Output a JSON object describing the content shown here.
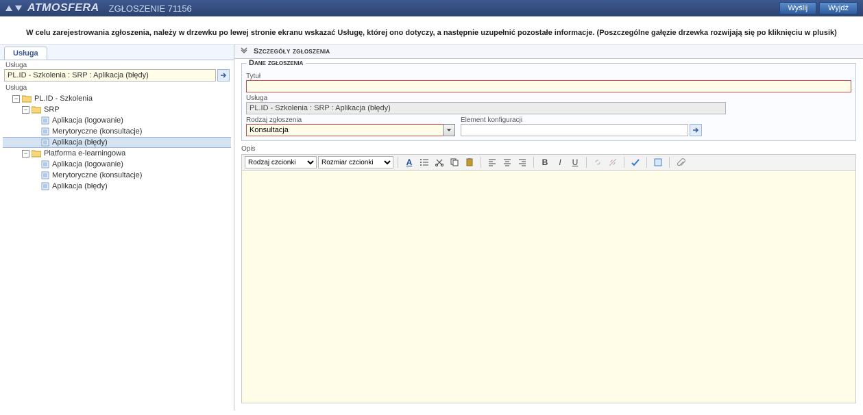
{
  "header": {
    "brand": "ATMOSFERA",
    "title": "ZGŁOSZENIE 71156",
    "send": "Wyślij",
    "exit": "Wyjdź"
  },
  "instruction": "W celu zarejestrowania zgłoszenia, należy w drzewku po lewej stronie ekranu wskazać Usługę, której ono dotyczy, a następnie uzupełnić pozostałe informacje. (Poszczególne gałęzie drzewka rozwijają się po kliknięciu w plusik)",
  "left": {
    "tab": "Usługa",
    "label1": "Usługa",
    "serviceValue": "PL.ID - Szkolenia : SRP : Aplikacja (błędy)",
    "label2": "Usługa",
    "tree": {
      "root": "PL.ID - Szkolenia",
      "branch1": "SRP",
      "b1_items": [
        "Aplikacja (logowanie)",
        "Merytoryczne (konsultacje)",
        "Aplikacja (błędy)"
      ],
      "branch2": "Platforma e-learningowa",
      "b2_items": [
        "Aplikacja (logowanie)",
        "Merytoryczne (konsultacje)",
        "Aplikacja (błędy)"
      ]
    }
  },
  "right": {
    "sectionTitle": "Szczegóły zgłoszenia",
    "fieldsetLegend": "Dane zgłoszenia",
    "titleLabel": "Tytuł",
    "titleValue": "",
    "serviceLabel": "Usługa",
    "serviceValue": "PL.ID - Szkolenia : SRP : Aplikacja (błędy)",
    "typeLabel": "Rodzaj zgłoszenia",
    "typeValue": "Konsultacja",
    "ciLabel": "Element konfiguracji",
    "ciValue": "",
    "descLabel": "Opis",
    "toolbar": {
      "fontFamily": "Rodzaj czcionki",
      "fontSize": "Rozmiar czcionki"
    }
  }
}
